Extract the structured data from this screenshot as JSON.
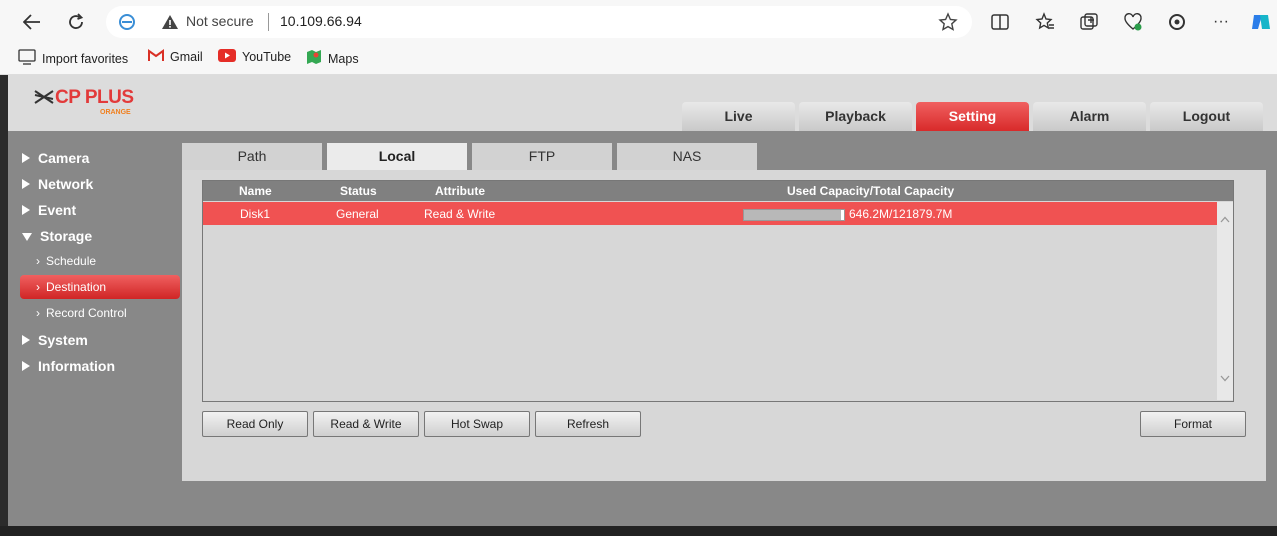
{
  "browser": {
    "security_label": "Not secure",
    "url": "10.109.66.94",
    "icons": [
      "back-icon",
      "refresh-icon",
      "edge-icon",
      "warning-icon",
      "favorite-star-icon",
      "split-screen-icon",
      "favorites-icon",
      "collections-icon",
      "browser-essentials-icon",
      "performance-icon",
      "more-icon",
      "copilot-icon"
    ],
    "bookmarks": [
      {
        "label": "Import favorites",
        "icon": "import-icon"
      },
      {
        "label": "Gmail",
        "icon": "gmail-icon"
      },
      {
        "label": "YouTube",
        "icon": "youtube-icon"
      },
      {
        "label": "Maps",
        "icon": "maps-icon"
      }
    ]
  },
  "logo": {
    "text": "CP PLUS",
    "sub": "ORANGE"
  },
  "main_nav": [
    {
      "label": "Live",
      "active": false
    },
    {
      "label": "Playback",
      "active": false
    },
    {
      "label": "Setting",
      "active": true
    },
    {
      "label": "Alarm",
      "active": false
    },
    {
      "label": "Logout",
      "active": false
    }
  ],
  "sidebar": {
    "items": [
      {
        "label": "Camera",
        "expanded": false
      },
      {
        "label": "Network",
        "expanded": false
      },
      {
        "label": "Event",
        "expanded": false
      },
      {
        "label": "Storage",
        "expanded": true
      },
      {
        "label": "System",
        "expanded": false
      },
      {
        "label": "Information",
        "expanded": false
      }
    ],
    "storage_sub": [
      {
        "label": "Schedule",
        "active": false
      },
      {
        "label": "Destination",
        "active": true
      },
      {
        "label": "Record Control",
        "active": false
      }
    ]
  },
  "tabs": [
    {
      "label": "Path",
      "active": false
    },
    {
      "label": "Local",
      "active": true
    },
    {
      "label": "FTP",
      "active": false
    },
    {
      "label": "NAS",
      "active": false
    }
  ],
  "table": {
    "columns": [
      "Name",
      "Status",
      "Attribute",
      "Used Capacity/Total Capacity"
    ],
    "rows": [
      {
        "name": "Disk1",
        "status": "General",
        "attribute": "Read & Write",
        "capacity": "646.2M/121879.7M",
        "used_fraction": 0.0053
      }
    ]
  },
  "buttons": {
    "read_only": "Read Only",
    "read_write": "Read & Write",
    "hot_swap": "Hot Swap",
    "refresh": "Refresh",
    "format": "Format"
  },
  "colors": {
    "accent": "#e23a3a",
    "row_selected": "#f05252"
  }
}
